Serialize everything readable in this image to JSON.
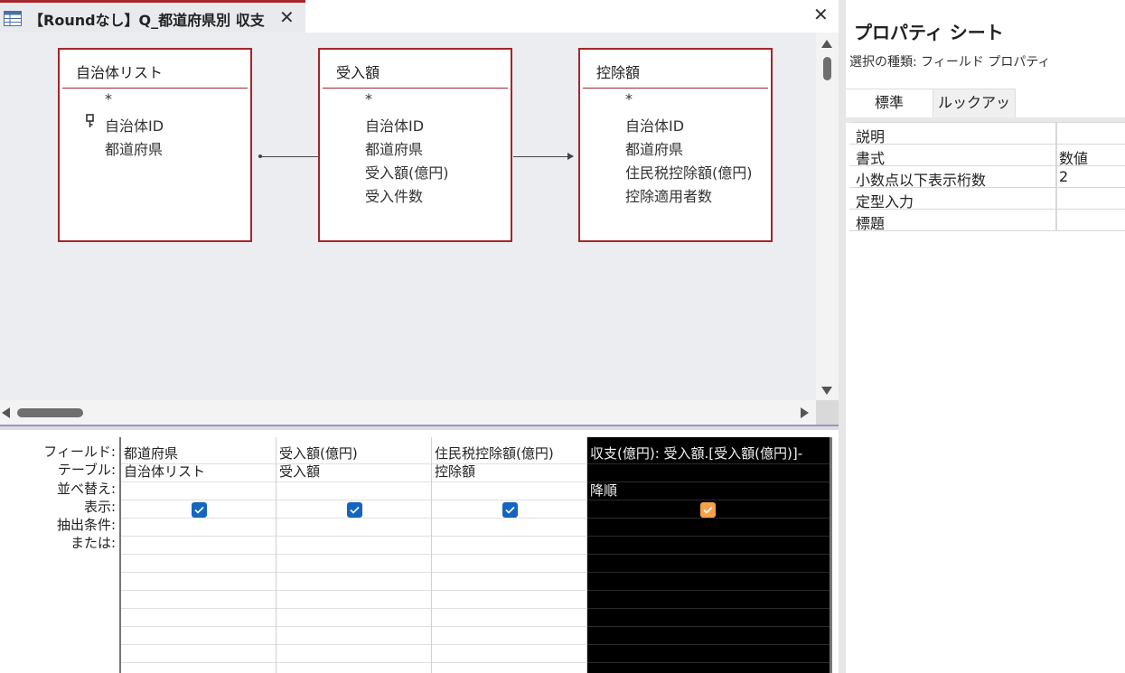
{
  "document_tab": {
    "title": "【Roundなし】Q_都道府県別 収支"
  },
  "tables": [
    {
      "name": "自治体リスト",
      "fields": [
        "*",
        "自治体ID",
        "都道府県"
      ],
      "key_field_index": 1
    },
    {
      "name": "受入額",
      "fields": [
        "*",
        "自治体ID",
        "都道府県",
        "受入額(億円)",
        "受入件数"
      ]
    },
    {
      "name": "控除額",
      "fields": [
        "*",
        "自治体ID",
        "都道府県",
        "住民税控除額(億円)",
        "控除適用者数"
      ]
    }
  ],
  "grid": {
    "row_labels": [
      "フィールド:",
      "テーブル:",
      "並べ替え:",
      "表示:",
      "抽出条件:",
      "または:"
    ],
    "columns": [
      {
        "field": "都道府県",
        "table": "自治体リスト",
        "sort": "",
        "show": true
      },
      {
        "field": "受入額(億円)",
        "table": "受入額",
        "sort": "",
        "show": true
      },
      {
        "field": "住民税控除額(億円)",
        "table": "控除額",
        "sort": "",
        "show": true
      },
      {
        "field": "収支(億円): 受入額.[受入額(億円)]-",
        "table": "",
        "sort": "降順",
        "show": true,
        "selected": true
      }
    ]
  },
  "property_sheet": {
    "title": "プロパティ シート",
    "selection_type": "選択の種類:  フィールド プロパティ",
    "tabs": [
      "標準",
      "ルックアップ"
    ],
    "active_tab": "標準",
    "properties": [
      {
        "name": "説明",
        "value": ""
      },
      {
        "name": "書式",
        "value": "数値"
      },
      {
        "name": "小数点以下表示桁数",
        "value": "2"
      },
      {
        "name": "定型入力",
        "value": ""
      },
      {
        "name": "標題",
        "value": ""
      }
    ]
  },
  "colors": {
    "accent": "#a4262c",
    "canvas": "#ebedf0",
    "checkbox_blue": "#1565c0",
    "checkbox_orange": "#f7a14a"
  }
}
